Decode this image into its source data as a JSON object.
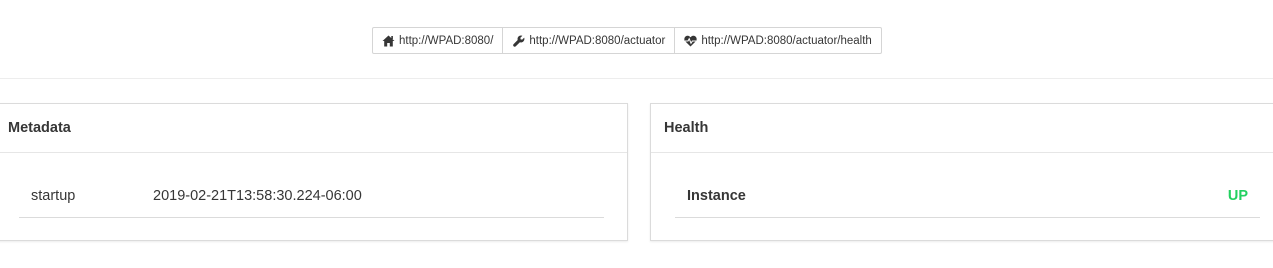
{
  "links": [
    {
      "icon": "home-icon",
      "label": "http://WPAD:8080/"
    },
    {
      "icon": "wrench-icon",
      "label": "http://WPAD:8080/actuator"
    },
    {
      "icon": "heartbeat-icon",
      "label": "http://WPAD:8080/actuator/health"
    }
  ],
  "metadata": {
    "title": "Metadata",
    "rows": [
      {
        "key": "startup",
        "value": "2019-02-21T13:58:30.224-06:00"
      }
    ]
  },
  "health": {
    "title": "Health",
    "instance_label": "Instance",
    "status": "UP",
    "status_color": "#23d160"
  }
}
